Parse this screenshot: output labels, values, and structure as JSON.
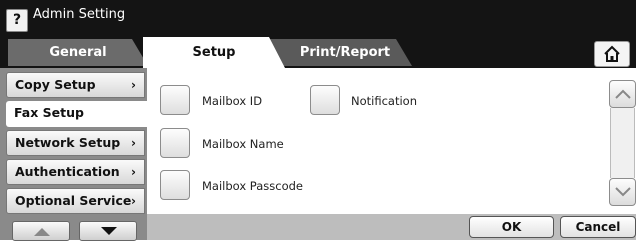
{
  "title_bar": {
    "help_label": "?",
    "title": "Admin Setting"
  },
  "tabs": [
    {
      "label": "General",
      "active": false
    },
    {
      "label": "Setup",
      "active": true
    },
    {
      "label": "Print/Report",
      "active": false
    }
  ],
  "home_icon": "home-icon",
  "sidebar": {
    "items": [
      {
        "label": "Copy Setup",
        "selected": false
      },
      {
        "label": "Fax Setup",
        "selected": true
      },
      {
        "label": "Network Setup",
        "selected": false
      },
      {
        "label": "Authentication",
        "selected": false
      },
      {
        "label": "Optional Service",
        "selected": false
      }
    ],
    "chevron": "›"
  },
  "options": {
    "mailbox_id": "Mailbox ID",
    "notification": "Notification",
    "mailbox_name": "Mailbox Name",
    "mailbox_passcode": "Mailbox Passcode"
  },
  "footer": {
    "ok_label": "OK",
    "cancel_label": "Cancel"
  },
  "colors": {
    "title_bar": "#141414",
    "sidebar_bg": "#8a8a8a",
    "bottom_bar": "#bdbdbd"
  }
}
